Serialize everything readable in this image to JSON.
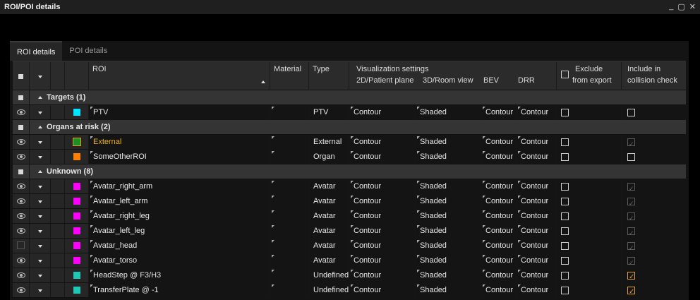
{
  "window": {
    "title": "ROI/POI details",
    "minimize": "_",
    "maximize": "▢",
    "close": "✕"
  },
  "tabs": [
    {
      "label": "ROI details",
      "active": true
    },
    {
      "label": "POI details",
      "active": false
    }
  ],
  "header": {
    "roi": "ROI",
    "material": "Material",
    "type": "Type",
    "vis": "Visualization settings",
    "vis2d": "2D/Patient plane",
    "vis3d": "3D/Room view",
    "bev": "BEV",
    "drr": "DRR",
    "exclude1": "Exclude",
    "exclude2": "from export",
    "include1": "Include in",
    "include2": "collision check"
  },
  "groups": [
    {
      "label": "Targets (1)"
    },
    {
      "label": "Organs at risk (2)"
    },
    {
      "label": "Unknown (8)"
    }
  ],
  "rows": [
    {
      "name": "PTV",
      "color": "#00e5ff",
      "type": "PTV",
      "v2d": "Contour",
      "v3d": "Shaded",
      "bev": "Contour",
      "drr": "Contour",
      "visible": true,
      "collision": "off"
    },
    {
      "name": "External",
      "color": "#1f8f1f",
      "highlight": true,
      "type": "External",
      "v2d": "Contour",
      "v3d": "Shaded",
      "bev": "Contour",
      "drr": "Contour",
      "visible": true,
      "collision": "dim"
    },
    {
      "name": "SomeOtherROI",
      "color": "#ff7f00",
      "type": "Organ",
      "v2d": "Contour",
      "v3d": "Shaded",
      "bev": "Contour",
      "drr": "Contour",
      "visible": true,
      "collision": "off"
    },
    {
      "name": "Avatar_right_arm",
      "color": "#ff00ff",
      "type": "Avatar",
      "v2d": "Contour",
      "v3d": "Shaded",
      "bev": "Contour",
      "drr": "Contour",
      "visible": true,
      "collision": "dim"
    },
    {
      "name": "Avatar_left_arm",
      "color": "#ff00ff",
      "type": "Avatar",
      "v2d": "Contour",
      "v3d": "Shaded",
      "bev": "Contour",
      "drr": "Contour",
      "visible": true,
      "collision": "dim"
    },
    {
      "name": "Avatar_right_leg",
      "color": "#ff00ff",
      "type": "Avatar",
      "v2d": "Contour",
      "v3d": "Shaded",
      "bev": "Contour",
      "drr": "Contour",
      "visible": true,
      "collision": "dim"
    },
    {
      "name": "Avatar_left_leg",
      "color": "#ff00ff",
      "type": "Avatar",
      "v2d": "Contour",
      "v3d": "Shaded",
      "bev": "Contour",
      "drr": "Contour",
      "visible": true,
      "collision": "dim"
    },
    {
      "name": "Avatar_head",
      "color": "#ff00ff",
      "type": "Avatar",
      "v2d": "Contour",
      "v3d": "Shaded",
      "bev": "Contour",
      "drr": "Contour",
      "visible": false,
      "collision": "dim"
    },
    {
      "name": "Avatar_torso",
      "color": "#ff00ff",
      "type": "Avatar",
      "v2d": "Contour",
      "v3d": "Shaded",
      "bev": "Contour",
      "drr": "Contour",
      "visible": true,
      "collision": "dim"
    },
    {
      "name": "HeadStep @ F3/H3",
      "color": "#1ec8b4",
      "type": "Undefined",
      "v2d": "Contour",
      "v3d": "Shaded",
      "bev": "Contour",
      "drr": "Contour",
      "visible": true,
      "collision": "on"
    },
    {
      "name": "TransferPlate @ -1",
      "color": "#1ec8b4",
      "type": "Undefined",
      "v2d": "Contour",
      "v3d": "Shaded",
      "bev": "Contour",
      "drr": "Contour",
      "visible": true,
      "collision": "on"
    }
  ]
}
